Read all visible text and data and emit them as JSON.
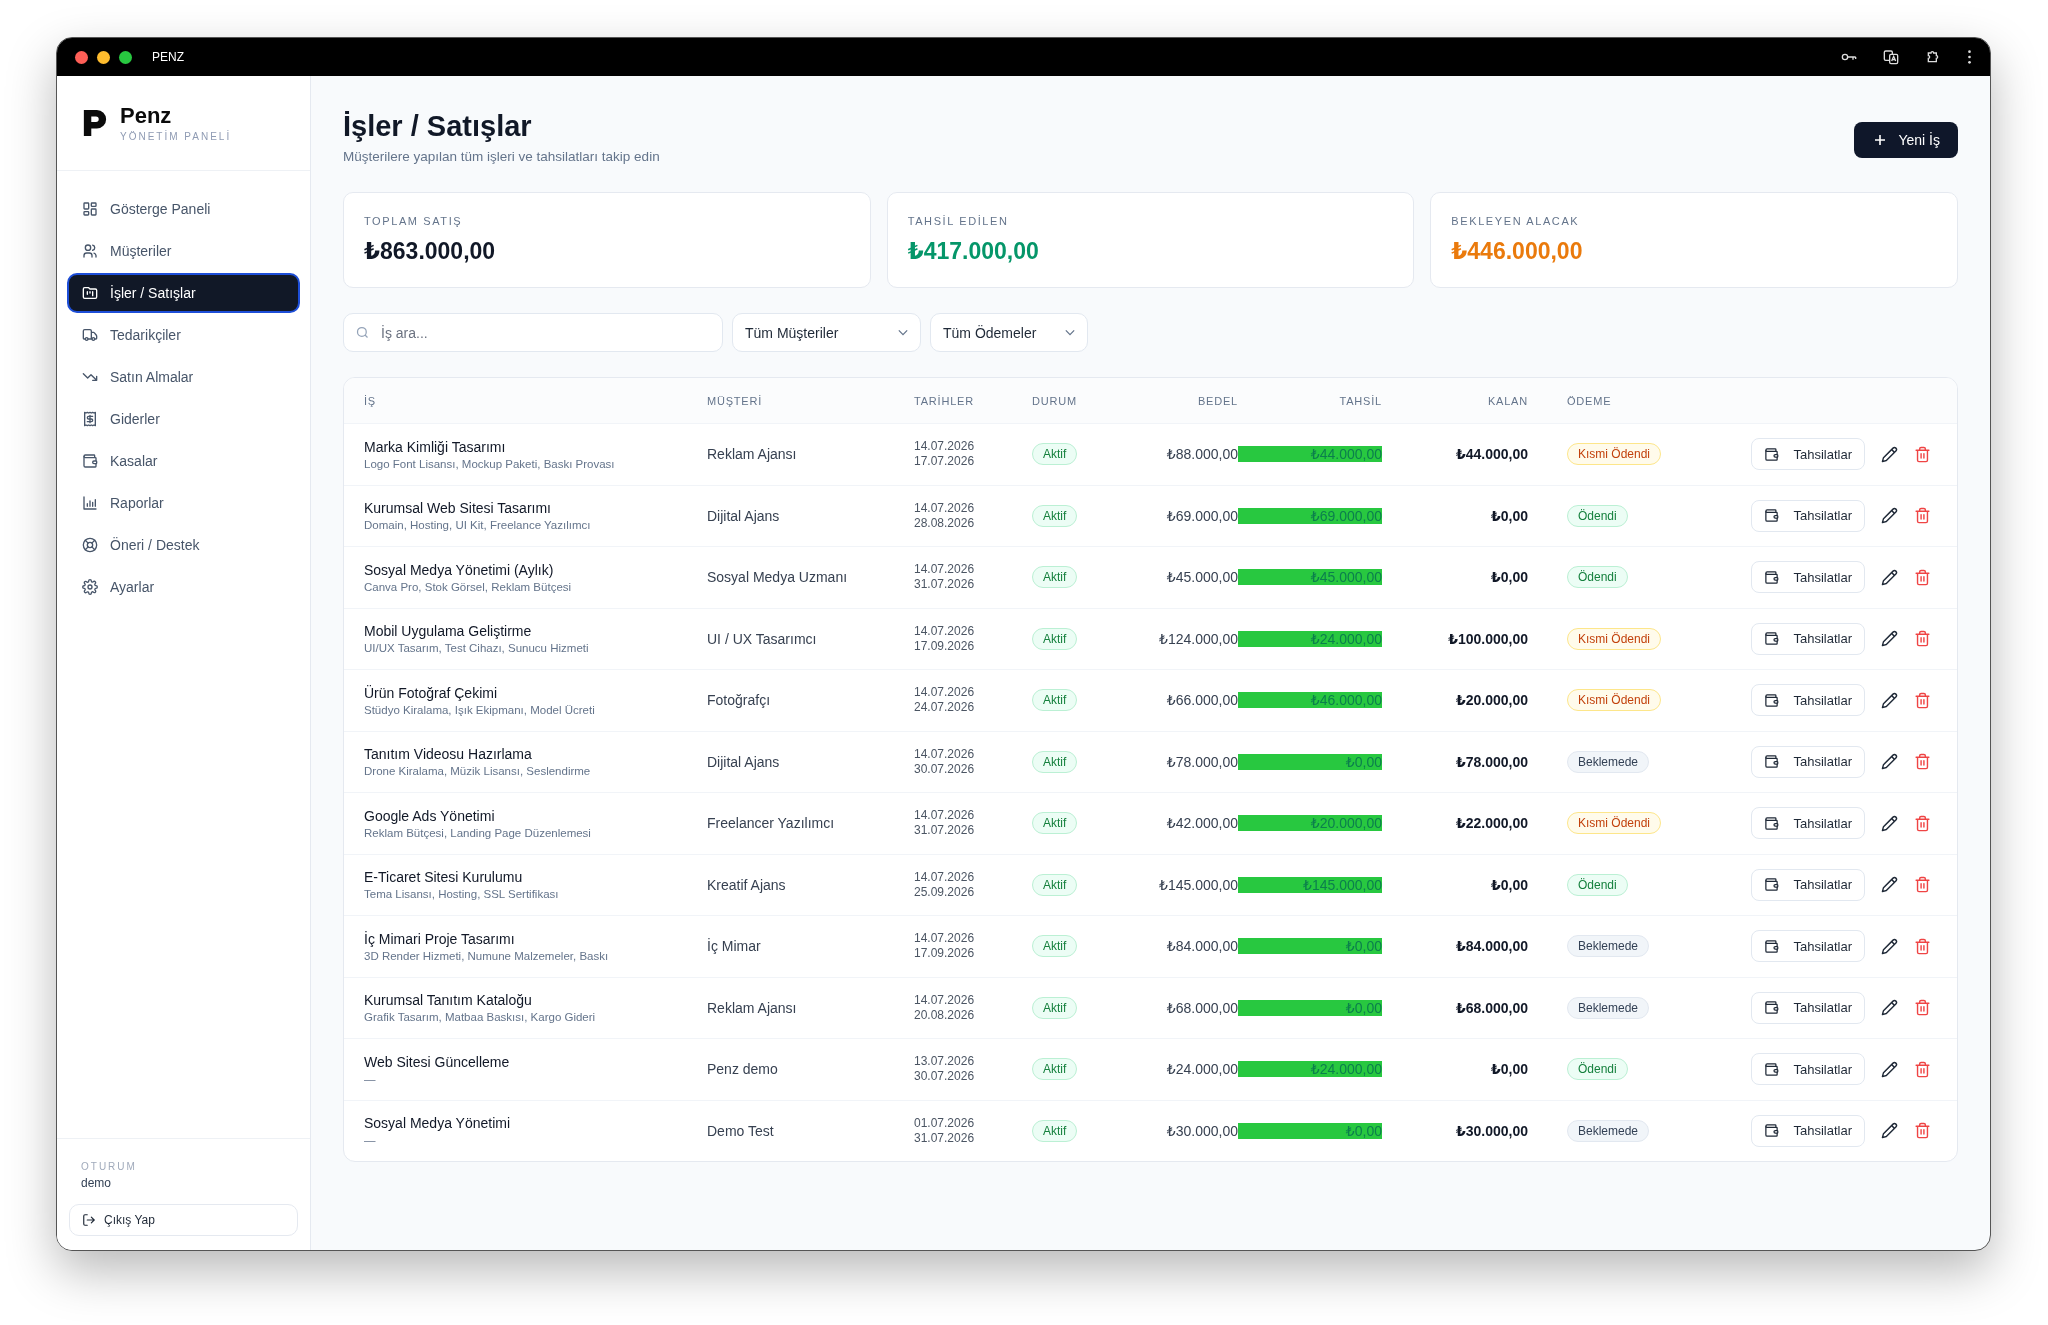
{
  "window": {
    "title": "PENZ"
  },
  "sidebar": {
    "brand": "Penz",
    "tagline": "YÖNETİM PANELİ",
    "items": [
      {
        "label": "Gösterge Paneli",
        "selected": false
      },
      {
        "label": "Müşteriler",
        "selected": false
      },
      {
        "label": "İşler / Satışlar",
        "selected": true
      },
      {
        "label": "Tedarikçiler",
        "selected": false
      },
      {
        "label": "Satın Almalar",
        "selected": false
      },
      {
        "label": "Giderler",
        "selected": false
      },
      {
        "label": "Kasalar",
        "selected": false
      },
      {
        "label": "Raporlar",
        "selected": false
      },
      {
        "label": "Öneri / Destek",
        "selected": false
      },
      {
        "label": "Ayarlar",
        "selected": false
      }
    ],
    "session_label": "OTURUM",
    "user": "demo",
    "logout": "Çıkış Yap"
  },
  "header": {
    "title": "İşler / Satışlar",
    "subtitle": "Müşterilere yapılan tüm işleri ve tahsilatları takip edin",
    "new_button": "Yeni İş"
  },
  "cards": [
    {
      "label": "TOPLAM SATIŞ",
      "value": "₺863.000,00",
      "kind": "total"
    },
    {
      "label": "TAHSİL EDİLEN",
      "value": "₺417.000,00",
      "kind": "collected"
    },
    {
      "label": "BEKLEYEN ALACAK",
      "value": "₺446.000,00",
      "kind": "pending"
    }
  ],
  "filters": {
    "search_placeholder": "İş ara...",
    "customer": "Tüm Müşteriler",
    "payment": "Tüm Ödemeler"
  },
  "table": {
    "columns": [
      "İŞ",
      "MÜŞTERİ",
      "TARİHLER",
      "DURUM",
      "BEDEL",
      "TAHSİL",
      "KALAN",
      "ÖDEME"
    ],
    "rows": [
      {
        "title": "Marka Kimliği Tasarımı",
        "items": "Logo Font Lisansı, Mockup Paketi, Baskı Provası",
        "customer": "Reklam Ajansı",
        "start": "14.07.2026",
        "end": "17.07.2026",
        "status": "Aktif",
        "price": "₺88.000,00",
        "collected": "₺44.000,00",
        "remaining": "₺44.000,00",
        "payment": {
          "label": "Kısmi Ödendi",
          "kind": "partial"
        },
        "action": "Tahsilatlar"
      },
      {
        "title": "Kurumsal Web Sitesi Tasarımı",
        "items": "Domain, Hosting, UI Kit, Freelance Yazılımcı",
        "customer": "Dijital Ajans",
        "start": "14.07.2026",
        "end": "28.08.2026",
        "status": "Aktif",
        "price": "₺69.000,00",
        "collected": "₺69.000,00",
        "remaining": "₺0,00",
        "payment": {
          "label": "Ödendi",
          "kind": "paid"
        },
        "action": "Tahsilatlar"
      },
      {
        "title": "Sosyal Medya Yönetimi (Aylık)",
        "items": "Canva Pro, Stok Görsel, Reklam Bütçesi",
        "customer": "Sosyal Medya Uzmanı",
        "start": "14.07.2026",
        "end": "31.07.2026",
        "status": "Aktif",
        "price": "₺45.000,00",
        "collected": "₺45.000,00",
        "remaining": "₺0,00",
        "payment": {
          "label": "Ödendi",
          "kind": "paid"
        },
        "action": "Tahsilatlar"
      },
      {
        "title": "Mobil Uygulama Geliştirme",
        "items": "UI/UX Tasarım, Test Cihazı, Sunucu Hizmeti",
        "customer": "UI / UX Tasarımcı",
        "start": "14.07.2026",
        "end": "17.09.2026",
        "status": "Aktif",
        "price": "₺124.000,00",
        "collected": "₺24.000,00",
        "remaining": "₺100.000,00",
        "payment": {
          "label": "Kısmi Ödendi",
          "kind": "partial"
        },
        "action": "Tahsilatlar"
      },
      {
        "title": "Ürün Fotoğraf Çekimi",
        "items": "Stüdyo Kiralama, Işık Ekipmanı, Model Ücreti",
        "customer": "Fotoğrafçı",
        "start": "14.07.2026",
        "end": "24.07.2026",
        "status": "Aktif",
        "price": "₺66.000,00",
        "collected": "₺46.000,00",
        "remaining": "₺20.000,00",
        "payment": {
          "label": "Kısmi Ödendi",
          "kind": "partial"
        },
        "action": "Tahsilatlar"
      },
      {
        "title": "Tanıtım Videosu Hazırlama",
        "items": "Drone Kiralama, Müzik Lisansı, Seslendirme",
        "customer": "Dijital Ajans",
        "start": "14.07.2026",
        "end": "30.07.2026",
        "status": "Aktif",
        "price": "₺78.000,00",
        "collected": "₺0,00",
        "remaining": "₺78.000,00",
        "payment": {
          "label": "Beklemede",
          "kind": "pending"
        },
        "action": "Tahsilatlar"
      },
      {
        "title": "Google Ads Yönetimi",
        "items": "Reklam Bütçesi, Landing Page Düzenlemesi",
        "customer": "Freelancer Yazılımcı",
        "start": "14.07.2026",
        "end": "31.07.2026",
        "status": "Aktif",
        "price": "₺42.000,00",
        "collected": "₺20.000,00",
        "remaining": "₺22.000,00",
        "payment": {
          "label": "Kısmi Ödendi",
          "kind": "partial"
        },
        "action": "Tahsilatlar"
      },
      {
        "title": "E-Ticaret Sitesi Kurulumu",
        "items": "Tema Lisansı, Hosting, SSL Sertifikası",
        "customer": "Kreatif Ajans",
        "start": "14.07.2026",
        "end": "25.09.2026",
        "status": "Aktif",
        "price": "₺145.000,00",
        "collected": "₺145.000,00",
        "remaining": "₺0,00",
        "payment": {
          "label": "Ödendi",
          "kind": "paid"
        },
        "action": "Tahsilatlar"
      },
      {
        "title": "İç Mimari Proje Tasarımı",
        "items": "3D Render Hizmeti, Numune Malzemeler, Baskı",
        "customer": "İç Mimar",
        "start": "14.07.2026",
        "end": "17.09.2026",
        "status": "Aktif",
        "price": "₺84.000,00",
        "collected": "₺0,00",
        "remaining": "₺84.000,00",
        "payment": {
          "label": "Beklemede",
          "kind": "pending"
        },
        "action": "Tahsilatlar"
      },
      {
        "title": "Kurumsal Tanıtım Kataloğu",
        "items": "Grafik Tasarım, Matbaa Baskısı, Kargo Gideri",
        "customer": "Reklam Ajansı",
        "start": "14.07.2026",
        "end": "20.08.2026",
        "status": "Aktif",
        "price": "₺68.000,00",
        "collected": "₺0,00",
        "remaining": "₺68.000,00",
        "payment": {
          "label": "Beklemede",
          "kind": "pending"
        },
        "action": "Tahsilatlar"
      },
      {
        "title": "Web Sitesi Güncelleme",
        "items": "—",
        "customer": "Penz demo",
        "start": "13.07.2026",
        "end": "30.07.2026",
        "status": "Aktif",
        "price": "₺24.000,00",
        "collected": "₺24.000,00",
        "remaining": "₺0,00",
        "payment": {
          "label": "Ödendi",
          "kind": "paid"
        },
        "action": "Tahsilatlar"
      },
      {
        "title": "Sosyal Medya Yönetimi",
        "items": "—",
        "customer": "Demo Test",
        "start": "01.07.2026",
        "end": "31.07.2026",
        "status": "Aktif",
        "price": "₺30.000,00",
        "collected": "₺0,00",
        "remaining": "₺30.000,00",
        "payment": {
          "label": "Beklemede",
          "kind": "pending"
        },
        "action": "Tahsilatlar"
      }
    ]
  }
}
